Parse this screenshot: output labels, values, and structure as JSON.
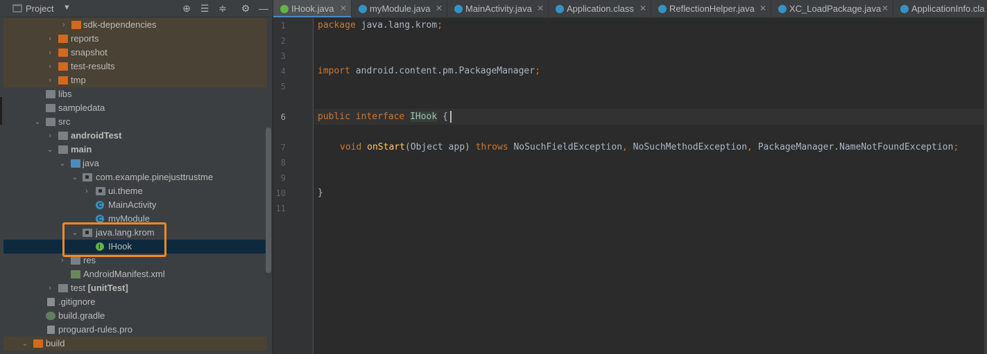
{
  "panel": {
    "title": "Project",
    "dropdown_icon": "chevron-down-icon",
    "buttons": [
      "locate-icon",
      "collapse-all-icon",
      "expand-all-icon",
      "gear-icon",
      "minimize-icon"
    ]
  },
  "tree": [
    {
      "label": "sdk-dependencies",
      "icon": "folder-orange"
    },
    {
      "label": "reports",
      "icon": "folder-orange"
    },
    {
      "label": "snapshot",
      "icon": "folder-orange"
    },
    {
      "label": "test-results",
      "icon": "folder-orange"
    },
    {
      "label": "tmp",
      "icon": "folder-orange"
    },
    {
      "label": "libs",
      "icon": "folder-gray"
    },
    {
      "label": "sampledata",
      "icon": "folder-gray"
    },
    {
      "label": "src",
      "icon": "folder-gray"
    },
    {
      "label": "androidTest",
      "icon": "folder-gray"
    },
    {
      "label": "main",
      "icon": "folder-gray"
    },
    {
      "label": "java",
      "icon": "folder-blue"
    },
    {
      "label": "com.example.pinejusttrustme",
      "icon": "package"
    },
    {
      "label": "ui.theme",
      "icon": "package"
    },
    {
      "label": "MainActivity",
      "icon": "class"
    },
    {
      "label": "myModule",
      "icon": "class"
    },
    {
      "label": "java.lang.krom",
      "icon": "package"
    },
    {
      "label": "IHook",
      "icon": "interface"
    },
    {
      "label": "res",
      "icon": "folder-gray"
    },
    {
      "label": "AndroidManifest.xml",
      "icon": "xml"
    },
    {
      "label_plain": "test ",
      "label_bold": "[unitTest]",
      "icon": "folder-gray"
    },
    {
      "label": ".gitignore",
      "icon": "file"
    },
    {
      "label": "build.gradle",
      "icon": "gradle"
    },
    {
      "label": "proguard-rules.pro",
      "icon": "file"
    },
    {
      "label": "build",
      "icon": "folder-orange"
    }
  ],
  "tabs": [
    {
      "label": "IHook.java",
      "icon": "interface",
      "active": true
    },
    {
      "label": "myModule.java",
      "icon": "class"
    },
    {
      "label": "MainActivity.java",
      "icon": "class"
    },
    {
      "label": "Application.class",
      "icon": "class"
    },
    {
      "label": "ReflectionHelper.java",
      "icon": "class"
    },
    {
      "label": "XC_LoadPackage.java",
      "icon": "class"
    },
    {
      "label": "ApplicationInfo.cla",
      "icon": "class"
    }
  ],
  "line_numbers": [
    "1",
    "2",
    "3",
    "4",
    "5",
    "6",
    "7",
    "8",
    "9",
    "10",
    "11"
  ],
  "code": {
    "line1": {
      "kw": "package",
      "rest": " java.lang.krom",
      "semi": ";"
    },
    "line4": {
      "kw": "import",
      "rest": " android.content.pm.PackageManager",
      "semi": ";"
    },
    "line6": {
      "kw1": "public",
      "kw2": "interface",
      "name": "IHook",
      "brace": " {"
    },
    "line7": {
      "kw": "void",
      "fn": "onStart",
      "params": "(Object app) ",
      "throws": "throws",
      "ex1": " NoSuchFieldException",
      "comma1": ",",
      "ex2": " NoSuchMethodException",
      "comma2": ",",
      "ex3": " PackageManager.NameNotFoundException",
      "semi": ";"
    },
    "line10": "}"
  }
}
